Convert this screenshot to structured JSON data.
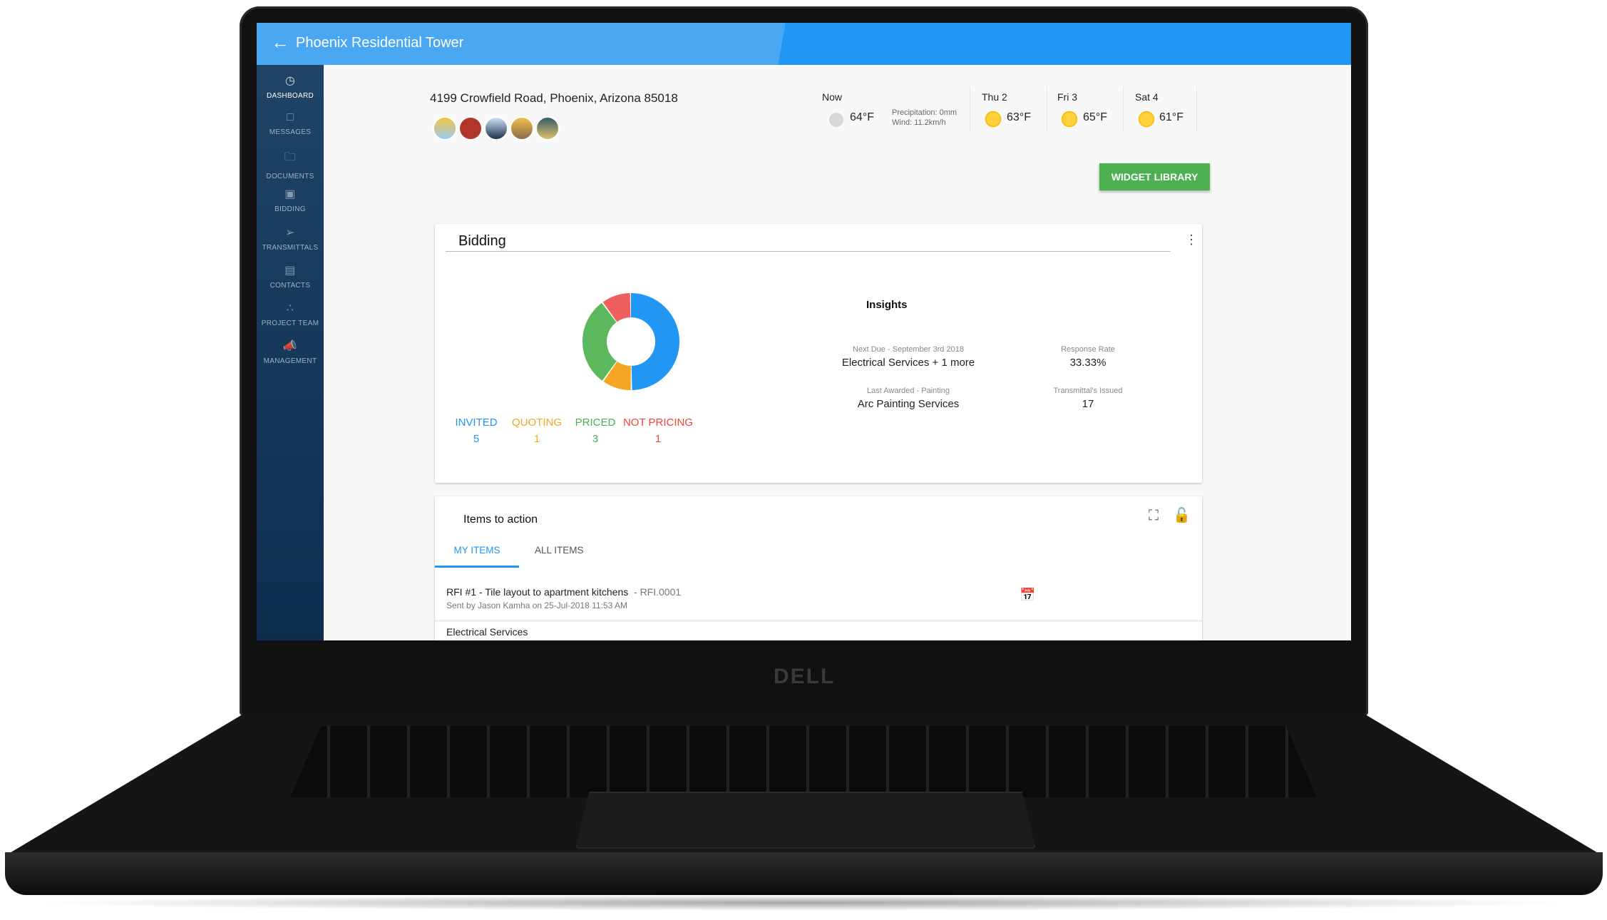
{
  "app": {
    "title": "Phoenix Residential Tower",
    "back_icon": "arrow-left-icon"
  },
  "sidebar": {
    "items": [
      {
        "label": "DASHBOARD",
        "icon": "gauge-icon",
        "active": true
      },
      {
        "label": "MESSAGES",
        "icon": "chat-icon"
      },
      {
        "label": "DOCUMENTS",
        "icon": "folder-icon"
      },
      {
        "label": "BIDDING",
        "icon": "bidding-icon"
      },
      {
        "label": "TRANSMITTALS",
        "icon": "send-icon"
      },
      {
        "label": "CONTACTS",
        "icon": "contacts-icon"
      },
      {
        "label": "PROJECT TEAM",
        "icon": "team-icon"
      },
      {
        "label": "MANAGEMENT",
        "icon": "megaphone-icon"
      }
    ]
  },
  "project": {
    "address": "4199 Crowfield Road, Phoenix, Arizona 85018"
  },
  "weather": {
    "now": {
      "label": "Now",
      "temp": "64°F",
      "precipitation": "Precipitation: 0mm",
      "wind": "Wind: 11.2km/h"
    },
    "forecast": [
      {
        "day": "Thu 2",
        "temp": "63°F",
        "icon": "partly-sunny-icon"
      },
      {
        "day": "Fri 3",
        "temp": "65°F",
        "icon": "partly-sunny-icon"
      },
      {
        "day": "Sat 4",
        "temp": "61°F",
        "icon": "sun-rain-icon"
      }
    ]
  },
  "toolbar": {
    "widget_library": "WIDGET LIBRARY"
  },
  "bidding": {
    "title": "Bidding",
    "stats": [
      {
        "label": "INVITED",
        "value": "5",
        "color": "#2196f3"
      },
      {
        "label": "QUOTING",
        "value": "1",
        "color": "#f5a623"
      },
      {
        "label": "PRICED",
        "value": "3",
        "color": "#4caf50"
      },
      {
        "label": "NOT PRICING",
        "value": "1",
        "color": "#f44336"
      }
    ],
    "chart_data": {
      "type": "pie",
      "categories": [
        "INVITED",
        "QUOTING",
        "PRICED",
        "NOT PRICING"
      ],
      "values": [
        5,
        1,
        3,
        1
      ],
      "colors": [
        "#2196f3",
        "#f5a623",
        "#5cb85c",
        "#ef5f5f"
      ]
    },
    "insights": {
      "title": "Insights",
      "items": [
        {
          "label": "Next Due - September 3rd 2018",
          "value": "Electrical Services + 1 more"
        },
        {
          "label": "Response Rate",
          "value": "33.33%"
        },
        {
          "label": "Last Awarded - Painting",
          "value": "Arc Painting Services"
        },
        {
          "label": "Transmittal's Issued",
          "value": "17"
        }
      ]
    }
  },
  "items_to_action": {
    "title": "Items to action",
    "tabs": [
      "MY ITEMS",
      "ALL ITEMS"
    ],
    "rows": [
      {
        "title": "RFI #1 - Tile layout to apartment kitchens",
        "code": "- RFI.0001",
        "subtitle": "Sent by Jason Kamha on 25-Jul-2018 11:53 AM"
      },
      {
        "title": "Electrical Services"
      }
    ]
  },
  "brand": {
    "logo": "DELL"
  }
}
